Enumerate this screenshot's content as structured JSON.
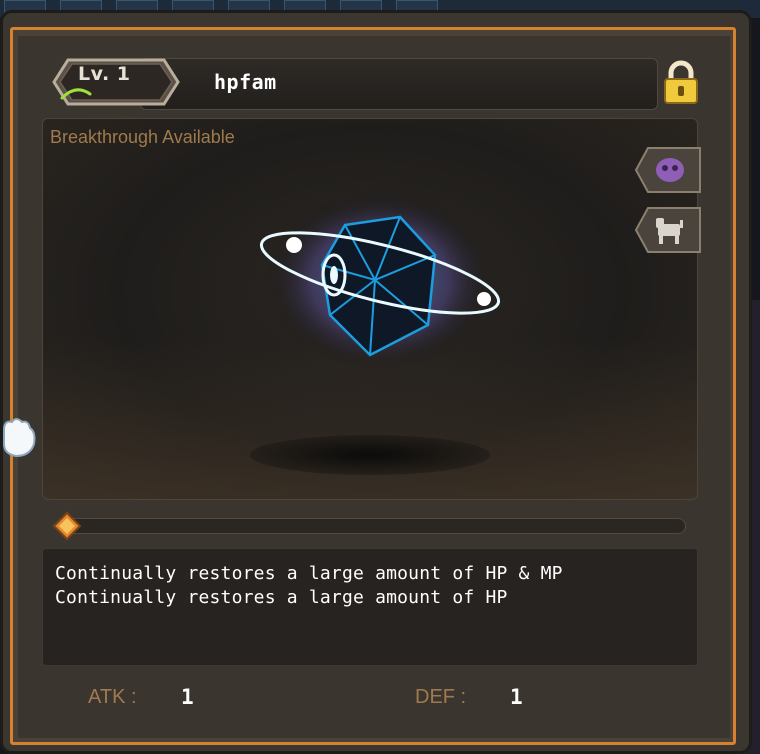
{
  "familiar": {
    "level_label": "Lv. 1",
    "name": "hpfam",
    "status": "Breakthrough Available",
    "effects": [
      "Continually restores a large amount of HP & MP",
      "Continually restores a large amount of HP"
    ],
    "progress_fraction": 0.0,
    "stats": {
      "atk_label": "ATK :",
      "atk_value": "1",
      "def_label": "DEF :",
      "def_value": "1"
    }
  },
  "icons": {
    "lock": "lock-icon",
    "mask_button": "mask-icon",
    "pet_button": "pet-icon",
    "progress_handle": "diamond-icon",
    "cursor": "hand-cursor-icon"
  },
  "colors": {
    "frame_accent": "#d5812e",
    "label_tan": "#a0794e",
    "gem_glow": "#3fd6ff"
  }
}
